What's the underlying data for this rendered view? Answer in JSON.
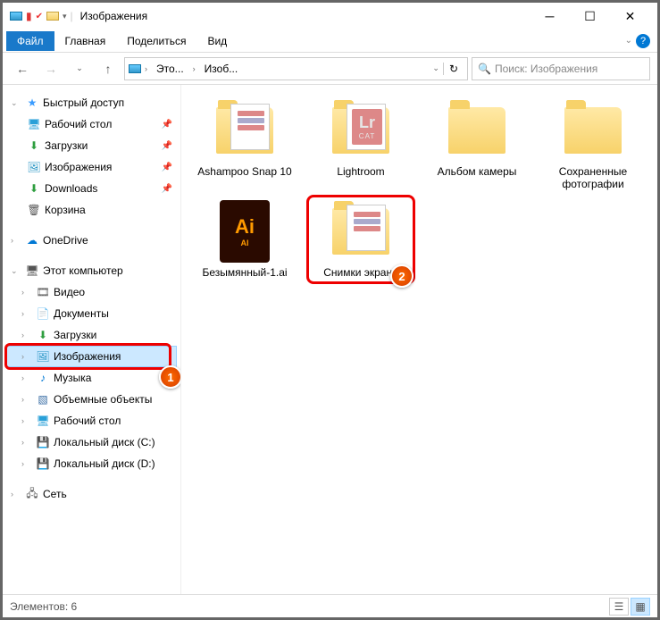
{
  "window": {
    "title": "Изображения"
  },
  "tabs": {
    "file": "Файл",
    "home": "Главная",
    "share": "Поделиться",
    "view": "Вид"
  },
  "nav": {
    "crumb1": "Это...",
    "crumb2": "Изоб...",
    "search_placeholder": "Поиск: Изображения"
  },
  "sidebar": {
    "quick": "Быстрый доступ",
    "desktop": "Рабочий стол",
    "downloads": "Загрузки",
    "images": "Изображения",
    "downloads2": "Downloads",
    "bin": "Корзина",
    "onedrive": "OneDrive",
    "pc": "Этот компьютер",
    "video": "Видео",
    "docs": "Документы",
    "downloads3": "Загрузки",
    "images2": "Изображения",
    "music": "Музыка",
    "objects3d": "Объемные объекты",
    "desktop2": "Рабочий стол",
    "diskC": "Локальный диск (C:)",
    "diskD": "Локальный диск (D:)",
    "network": "Сеть"
  },
  "items": {
    "ashampoo": "Ashampoo Snap 10",
    "lightroom": "Lightroom",
    "camera": "Альбом камеры",
    "saved": "Сохраненные фотографии",
    "ai_file": "Безымянный-1.ai",
    "screenshots": "Снимки экрана"
  },
  "status": {
    "count": "Элементов: 6"
  },
  "annotations": {
    "b1": "1",
    "b2": "2"
  }
}
